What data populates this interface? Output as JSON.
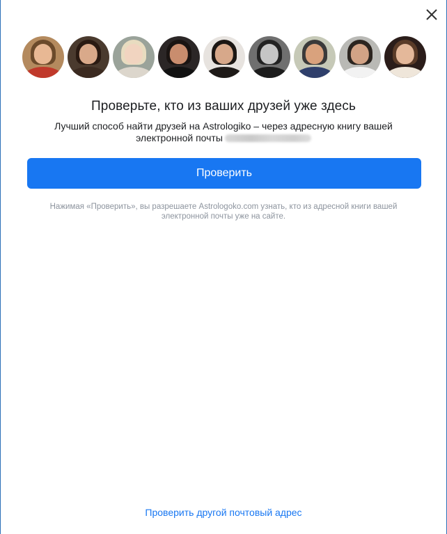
{
  "dialog": {
    "close_icon": "close-icon",
    "headline": "Проверьте, кто из ваших друзей уже здесь",
    "subtitle": "Лучший способ найти друзей на Astrologiko – через адресную книгу вашей электронной почты",
    "primary_button": "Проверить",
    "disclaimer": "Нажимая «Проверить», вы разрешаете Astrologoko.com узнать, кто из адресной книги вашей электронной почты уже на сайте.",
    "alt_link": "Проверить другой почтовый адрес"
  },
  "avatars": [
    {
      "bg": "#b48a5e",
      "hair": "#6b4a2b",
      "face": "#e8b894",
      "body": "#c0392b"
    },
    {
      "bg": "#4a3a2e",
      "hair": "#2a1a12",
      "face": "#d9a98a",
      "body": "#3b2a20"
    },
    {
      "bg": "#9aa39a",
      "hair": "#e8dcc0",
      "face": "#f1d4c0",
      "body": "#dcd6cc"
    },
    {
      "bg": "#2b2626",
      "hair": "#1a1412",
      "face": "#c98d6e",
      "body": "#111111"
    },
    {
      "bg": "#e7e3df",
      "hair": "#1b1613",
      "face": "#d7a88a",
      "body": "#1e1a18"
    },
    {
      "bg": "#6f6f6f",
      "hair": "#222222",
      "face": "#c5c5c5",
      "body": "#1c1c1c"
    },
    {
      "bg": "#c6c9b7",
      "hair": "#3a3a3a",
      "face": "#d9a27d",
      "body": "#2f3f6b"
    },
    {
      "bg": "#b9b9b5",
      "hair": "#2c2520",
      "face": "#d2a386",
      "body": "#f2f2f2"
    },
    {
      "bg": "#2b1d1a",
      "hair": "#5a3b28",
      "face": "#e4b89a",
      "body": "#efe6da"
    }
  ],
  "colors": {
    "accent": "#1877f2",
    "text": "#1c1e21",
    "muted": "#8d949e"
  }
}
